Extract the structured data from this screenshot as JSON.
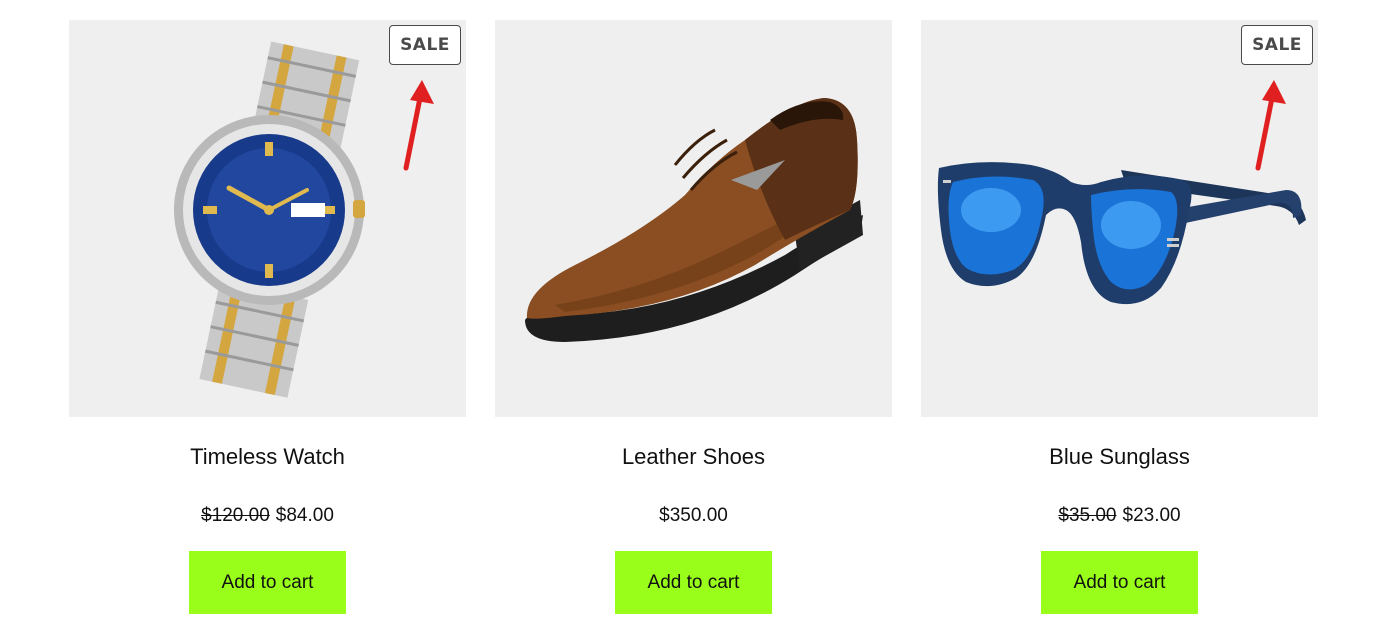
{
  "products": [
    {
      "name": "Timeless Watch",
      "old_price": "$120.00",
      "price": "$84.00",
      "badge": "SALE",
      "button": "Add to cart"
    },
    {
      "name": "Leather Shoes",
      "old_price": "",
      "price": "$350.00",
      "badge": "",
      "button": "Add to cart"
    },
    {
      "name": "Blue Sunglass",
      "old_price": "$35.00",
      "price": "$23.00",
      "badge": "SALE",
      "button": "Add to cart"
    }
  ],
  "colors": {
    "button_bg": "#99ff1a",
    "image_bg": "#efefef",
    "arrow": "#e02020"
  },
  "icons": {
    "annotation": "red-arrow-icon"
  }
}
